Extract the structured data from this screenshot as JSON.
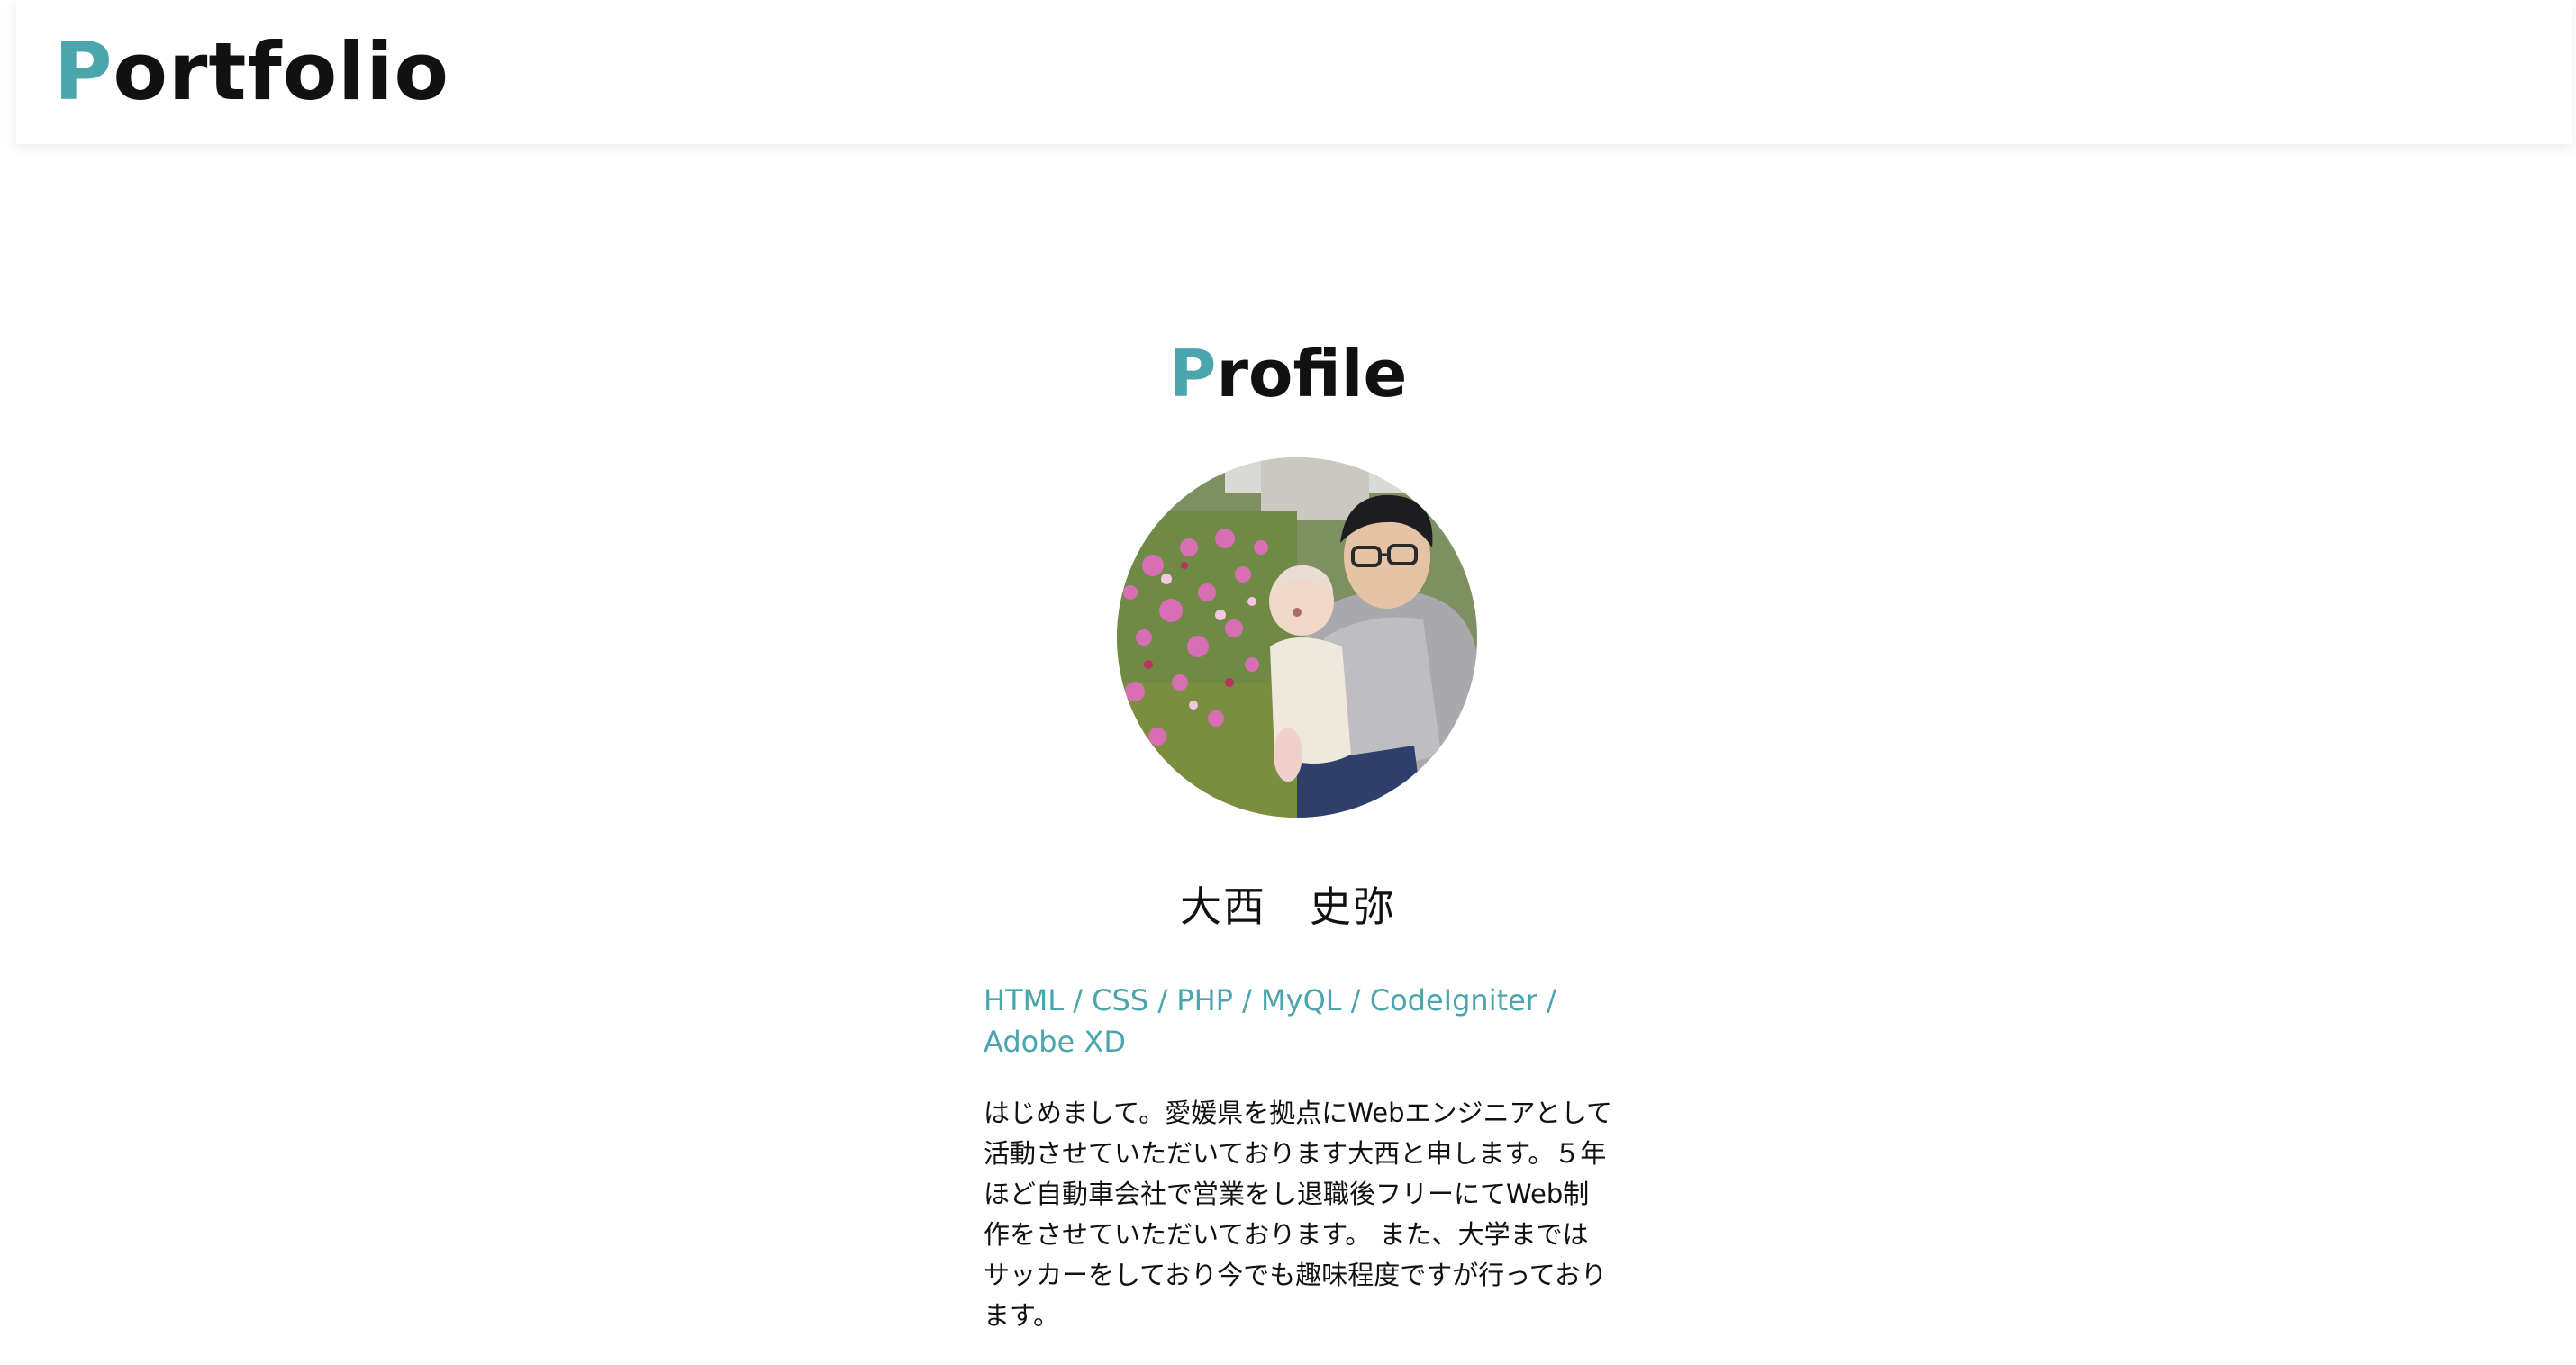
{
  "header": {
    "logo_first": "P",
    "logo_rest": "ortfolio"
  },
  "profile": {
    "title_first": "P",
    "title_rest": "rofile",
    "photo": "profile-photo-man-holding-baby-in-cosmos-flowers",
    "name": "大西　史弥",
    "skills": "HTML / CSS / PHP / MyQL / CodeIgniter / Adobe XD",
    "bio": "はじめまして。愛媛県を拠点にWebエンジニアとして活動させていただいております大西と申します。５年ほど自動車会社で営業をし退職後フリーにてWeb制作をさせていただいております。 また、大学まではサッカーをしており今でも趣味程度ですが行っております。"
  },
  "colors": {
    "accent": "#4aa5ac",
    "text": "#111111",
    "background": "#ffffff"
  }
}
